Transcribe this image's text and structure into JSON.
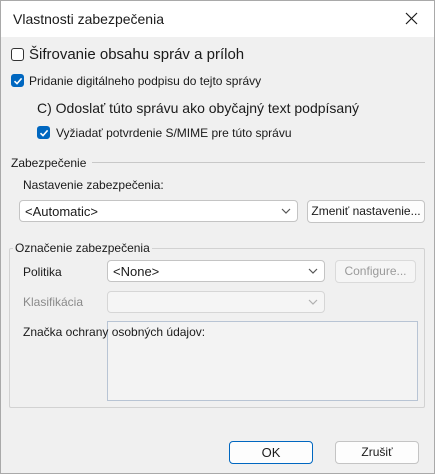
{
  "window": {
    "title": "Vlastnosti zabezpečenia"
  },
  "encrypt": {
    "label": "Šifrovanie obsahu správ a príloh",
    "checked": false
  },
  "sign": {
    "label": "Pridanie digitálneho podpisu do tejto správy",
    "checked": true
  },
  "cleartext": {
    "label": "C) Odoslať túto správu ako obyčajný text podpísaný",
    "checked": false
  },
  "smime_receipt": {
    "label": "Vyžiadať potvrdenie S/MIME pre túto správu",
    "checked": true
  },
  "security": {
    "section_label": "Zabezpečenie",
    "setting_label": "Nastavenie zabezpečenia:",
    "setting_value": "<Automatic>",
    "change_button": "Zmeniť nastavenie..."
  },
  "security_label": {
    "group_label": "Označenie zabezpečenia",
    "policy_label": "Politika",
    "policy_value": "<None>",
    "configure_button": "Configure...",
    "classification_label": "Klasifikácia",
    "classification_value": "",
    "privacy_label": "Značka ochrany osobných údajov:"
  },
  "footer": {
    "ok_label": "OK",
    "cancel_label": "Zrušiť"
  },
  "colors": {
    "accent": "#0067c0",
    "background": "#f0f0f0"
  },
  "icons": {
    "close": "close-icon",
    "checkmark": "checkmark-icon",
    "chevron": "chevron-down-icon"
  }
}
